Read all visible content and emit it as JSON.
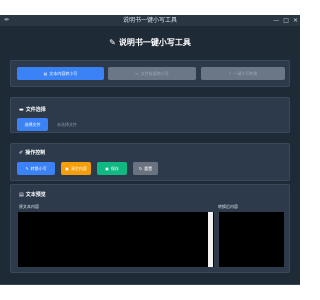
{
  "window": {
    "title": "说明书一键小写工具",
    "icon": "feather-icon",
    "controls": {
      "minimize": "—",
      "maximize": "□",
      "close": "✕"
    }
  },
  "app": {
    "title": "说明书一键小写工具",
    "title_icon": "pen-icon"
  },
  "nav": {
    "buttons": [
      {
        "label": "文本内容转小写",
        "state": "active"
      },
      {
        "label": "文件批量转小写",
        "state": "disabled"
      },
      {
        "label": "一键小写转换",
        "state": "disabled"
      }
    ]
  },
  "file_section": {
    "title": "文件选择",
    "select_button": "选择文件",
    "file_status": "未选择文件"
  },
  "ops_section": {
    "title": "操作控制",
    "buttons": {
      "convert": "转换小写",
      "clear": "清空内容",
      "save": "保存",
      "reset": "重置"
    }
  },
  "text_section": {
    "title": "文本预览",
    "original_label": "原文本内容",
    "converted_label": "转换后内容",
    "original_text": "",
    "converted_text": ""
  },
  "colors": {
    "background": "#1f2a37",
    "panel": "#2d3a4b",
    "primary": "#3b82f6",
    "warning": "#f59e0b",
    "success": "#10b981",
    "neutral": "#6b7280"
  }
}
